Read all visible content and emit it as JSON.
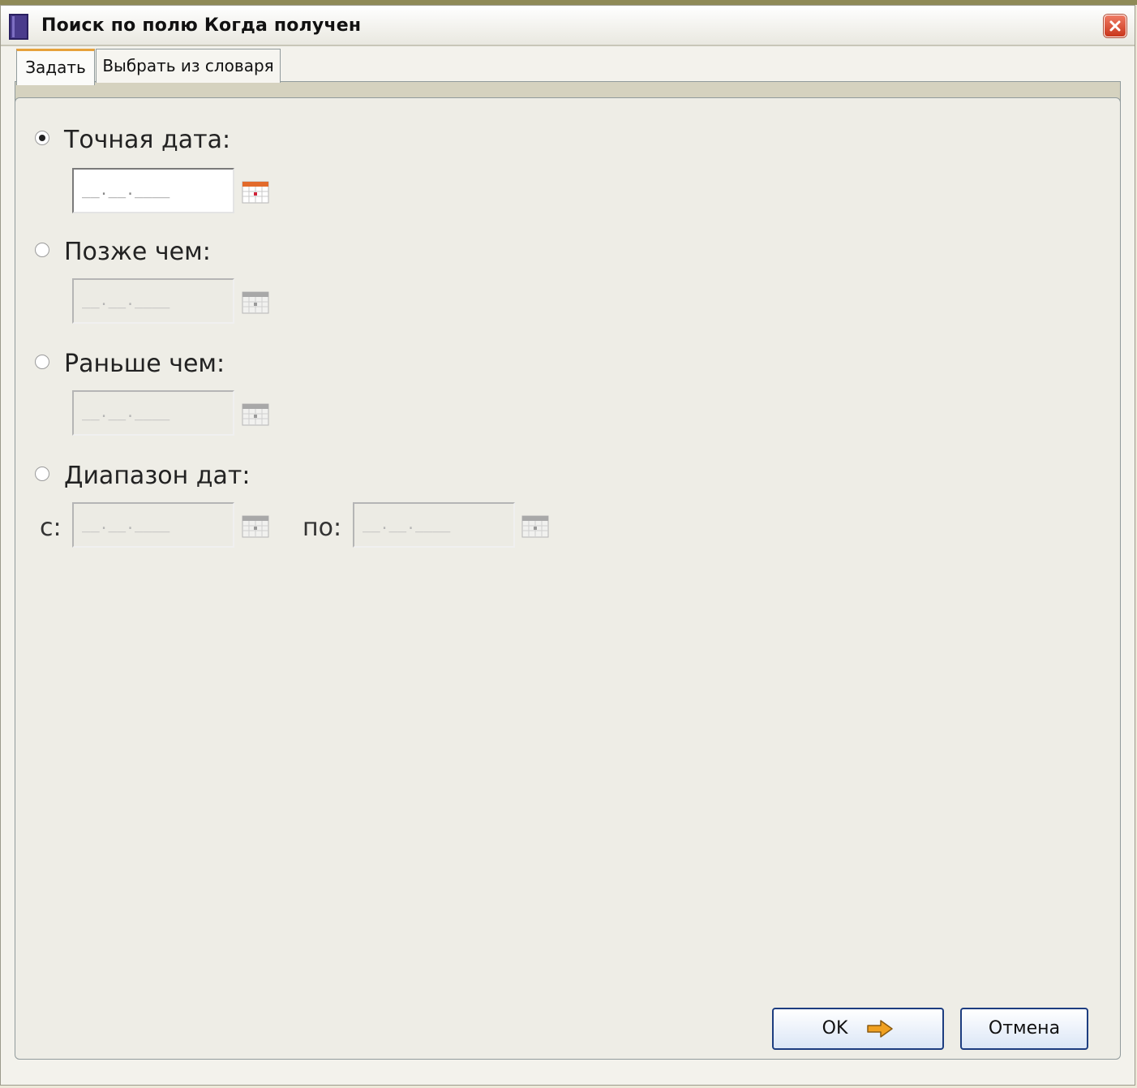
{
  "window": {
    "title": "Поиск по полю Когда получен"
  },
  "tabs": [
    {
      "label": "Задать",
      "active": true
    },
    {
      "label": "Выбрать из словаря",
      "active": false
    }
  ],
  "options": {
    "exact": {
      "label": "Точная дата:",
      "checked": true,
      "mask": "__.__.____"
    },
    "after": {
      "label": "Позже чем:",
      "checked": false,
      "mask": "__.__.____"
    },
    "before": {
      "label": "Раньше чем:",
      "checked": false,
      "mask": "__.__.____"
    },
    "range": {
      "label": "Диапазон дат:",
      "checked": false,
      "from_label": "с:",
      "to_label": "по:",
      "from_mask": "__.__.____",
      "to_mask": "__.__.____"
    }
  },
  "buttons": {
    "ok": "OK",
    "cancel": "Отмена"
  },
  "icons": {
    "app": "book-icon",
    "close": "close-icon",
    "calendar": "calendar-icon",
    "ok_arrow": "arrow-right-icon"
  },
  "colors": {
    "accent_orange": "#f0a020",
    "close_red": "#d9462b",
    "button_border": "#1d3d80"
  }
}
